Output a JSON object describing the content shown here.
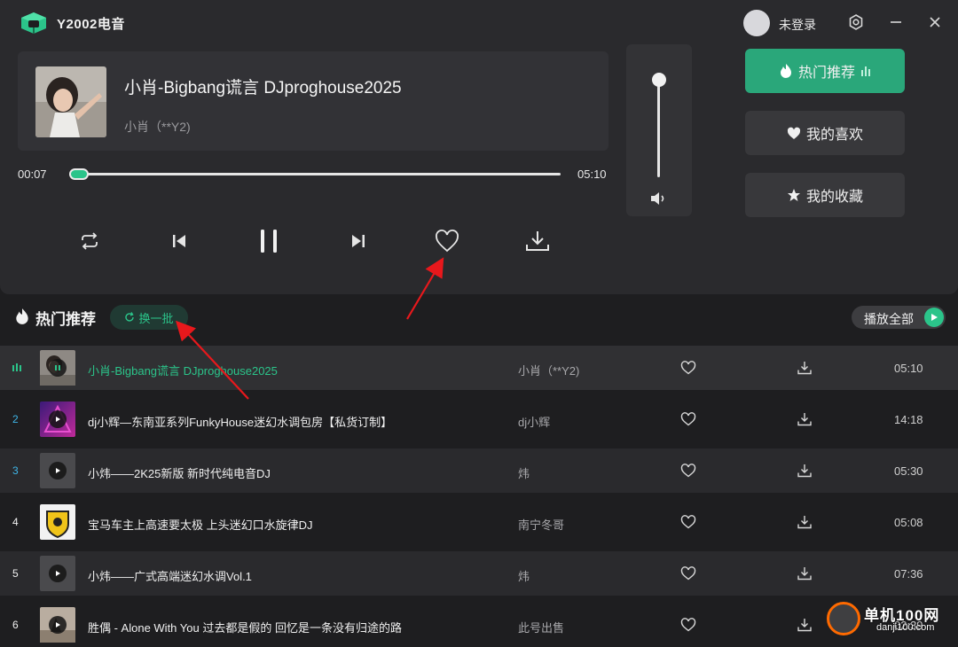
{
  "app": {
    "title": "Y2002电音",
    "login": "未登录"
  },
  "now_playing": {
    "title": "小肖-Bigbang谎言 DJproghouse2025",
    "artist": "小肖（**Y2)",
    "current_time": "00:07",
    "total_time": "05:10",
    "progress": 0.023,
    "volume": 0.95
  },
  "sidebar": {
    "items": [
      {
        "label": "热门推荐",
        "icon": "flame-icon",
        "active": true
      },
      {
        "label": "我的喜欢",
        "icon": "heart-icon",
        "active": false
      },
      {
        "label": "我的收藏",
        "icon": "star-icon",
        "active": false
      }
    ]
  },
  "section": {
    "title": "热门推荐",
    "refresh_label": "换一批",
    "play_all_label": "播放全部"
  },
  "tracks": [
    {
      "num": "",
      "title": "小肖-Bigbang谎言 DJproghouse2025",
      "artist": "小肖（**Y2)",
      "duration": "05:10",
      "playing": true
    },
    {
      "num": "2",
      "title": "dj小辉—东南亚系列FunkyHouse迷幻水调包房【私货订制】",
      "artist": "dj小辉",
      "duration": "14:18"
    },
    {
      "num": "3",
      "title": "小炜——2K25新版 新时代纯电音DJ",
      "artist": "炜",
      "duration": "05:30"
    },
    {
      "num": "4",
      "title": "宝马车主上高速要太极 上头迷幻口水旋律DJ",
      "artist": "南宁冬哥",
      "duration": "05:08"
    },
    {
      "num": "5",
      "title": "小炜——广式高端迷幻水调Vol.1",
      "artist": "炜",
      "duration": "07:36"
    },
    {
      "num": "6",
      "title": "胜偶 - Alone With You 过去都是假的 回忆是一条没有归途的路",
      "artist": "此号出售",
      "duration": "02:39"
    }
  ],
  "colors": {
    "accent": "#2bc48a",
    "background": "#1e1e20",
    "panel": "#2a2a2d"
  },
  "watermark": {
    "line1": "单机100网",
    "line2": "danji100.com"
  }
}
